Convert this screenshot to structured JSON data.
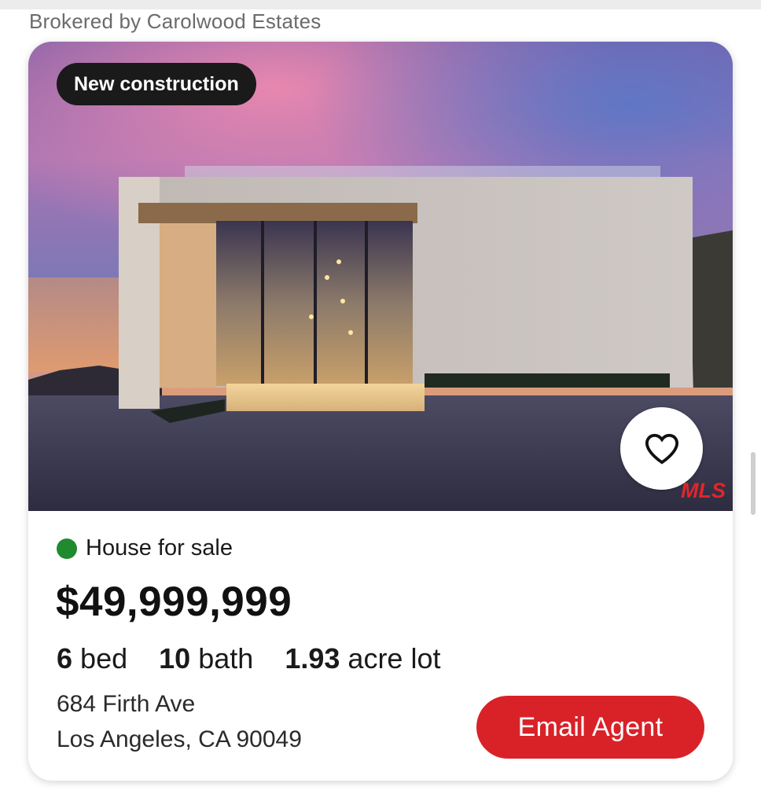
{
  "header": {
    "brokered_by": "Brokered by Carolwood Estates"
  },
  "listing": {
    "badge": "New construction",
    "favorite_icon": "heart-outline-icon",
    "mls_logo_text": "MLS",
    "status": "House for sale",
    "status_color": "#1f8a2e",
    "price": "$49,999,999",
    "beds_value": "6",
    "beds_label": "bed",
    "baths_value": "10",
    "baths_label": "bath",
    "lot_value": "1.93",
    "lot_label": "acre lot",
    "address_line1": "684 Firth Ave",
    "address_line2": "Los Angeles, CA 90049",
    "email_button": "Email Agent",
    "accent_color": "#d92228"
  }
}
